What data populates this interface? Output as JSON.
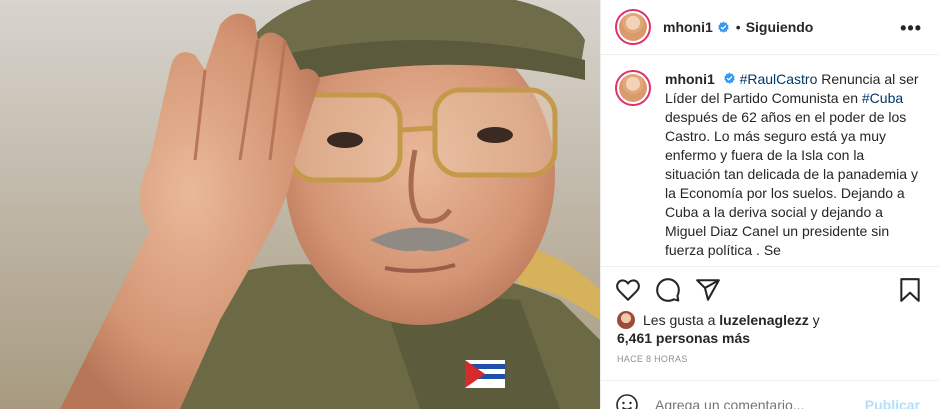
{
  "post": {
    "username": "mhoni1",
    "dot": "•",
    "follow_status": "Siguiendo",
    "more": "•••",
    "caption": {
      "username": "mhoni1",
      "hashtag_1": "#RaulCastro",
      "text_1": " Renuncia al ser Líder del Partido Comunista en ",
      "hashtag_2": "#Cuba",
      "text_2": " después de 62 años en el poder de los Castro. Lo más seguro está ya muy enfermo y fuera de la Isla con la situación tan delicada de la panademia y la Economía por los suelos. Dejando a Cuba a la deriva social y dejando a Miguel Diaz Canel un presidente sin fuerza política . Se"
    },
    "likes": {
      "prefix": "Les gusta a ",
      "user": "luzelenaglezz",
      "suffix": " y",
      "count": "6,461 personas más"
    },
    "time": "HACE 8 HORAS",
    "comment_placeholder": "Agrega un comentario...",
    "publish_label": "Publicar"
  },
  "icons": {
    "verified": "verified-badge-icon",
    "like": "heart-icon",
    "comment": "comment-icon",
    "share": "share-icon",
    "save": "bookmark-icon",
    "emoji": "emoji-icon",
    "more": "more-options-icon"
  },
  "colors": {
    "verified": "#3897f0",
    "hashtag": "#00376b",
    "publish_disabled": "#b2dffc",
    "story_ring": "#e1306c"
  }
}
